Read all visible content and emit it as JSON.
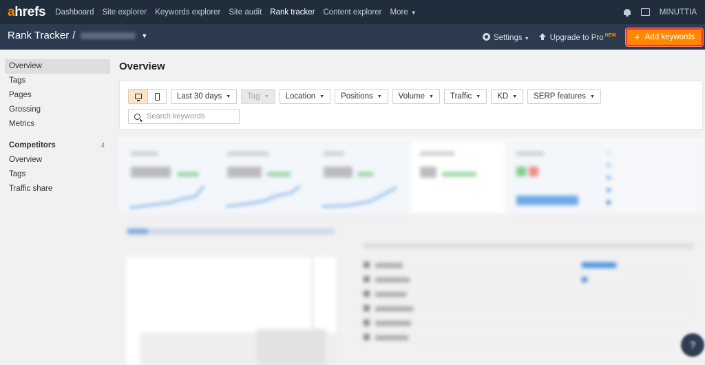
{
  "topnav": {
    "logo_a": "a",
    "logo_rest": "hrefs",
    "links": [
      {
        "label": "Dashboard"
      },
      {
        "label": "Site explorer"
      },
      {
        "label": "Keywords explorer"
      },
      {
        "label": "Site audit"
      },
      {
        "label": "Rank tracker"
      },
      {
        "label": "Content explorer"
      },
      {
        "label": "More"
      }
    ],
    "active": "Rank tracker",
    "user": "MINUTTIA"
  },
  "subheader": {
    "title": "Rank Tracker",
    "separator": "/",
    "settings_label": "Settings",
    "upgrade_label": "Upgrade to Pro",
    "new_badge": "NEW",
    "add_keywords_label": "Add keywords"
  },
  "sidebar": {
    "items": [
      "Overview",
      "Tags",
      "Pages",
      "Grossing",
      "Metrics"
    ],
    "competitors_heading": "Competitors",
    "competitors_count": "4",
    "competitor_items": [
      "Overview",
      "Tags",
      "Traffic share"
    ]
  },
  "main": {
    "title": "Overview",
    "filters": {
      "date": "Last 30 days",
      "tag": "Tag",
      "location": "Location",
      "positions": "Positions",
      "volume": "Volume",
      "traffic": "Traffic",
      "kd": "KD",
      "serp": "SERP features"
    },
    "search_placeholder": "Search keywords"
  },
  "colors": {
    "topnav_bg": "#202d3d",
    "subheader_bg": "#2c3b4f",
    "accent": "#ff8800",
    "highlight_border": "#e53935"
  },
  "help_icon": "?"
}
